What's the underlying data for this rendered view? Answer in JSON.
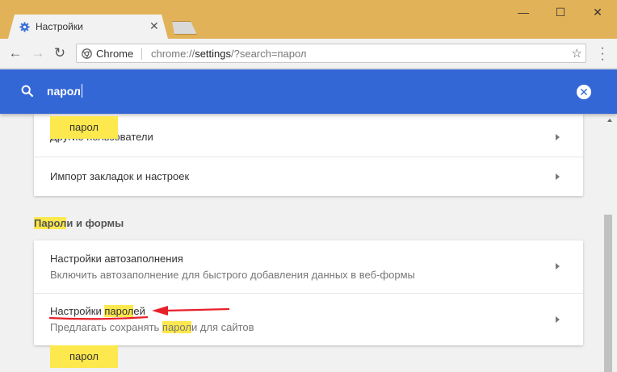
{
  "tab": {
    "title": "Настройки",
    "close": "✕"
  },
  "window": {
    "minimize": "—",
    "maximize": "☐",
    "close": "✕"
  },
  "toolbar": {
    "back": "←",
    "forward": "→",
    "reload": "↻",
    "omnibox_site": "Chrome",
    "url_scheme": "chrome://",
    "url_host": "settings",
    "url_rest": "/?search=парол",
    "star": "☆",
    "menu": "⋮"
  },
  "search": {
    "value": "парол",
    "clear": "✕"
  },
  "bubbles": {
    "top": "парол",
    "bottom": "парол"
  },
  "card1": {
    "rows": [
      {
        "title": "Другие пользователи"
      },
      {
        "title": "Импорт закладок и настроек"
      }
    ]
  },
  "section": {
    "title_highlight": "Парол",
    "title_rest": "и и формы"
  },
  "card2": {
    "autofill": {
      "title": "Настройки автозаполнения",
      "subtitle": "Включить автозаполнение для быстрого добавления данных в веб-формы"
    },
    "passwords": {
      "title_a": "Настройки ",
      "title_hl": "парол",
      "title_b": "ей",
      "sub_a": "Предлагать сохранять ",
      "sub_hl": "парол",
      "sub_b": "и для сайтов"
    }
  },
  "colors": {
    "header": "#3367d6",
    "titlebar": "#e2b258",
    "highlight": "#fde84d",
    "annotation": "#e8202a"
  }
}
